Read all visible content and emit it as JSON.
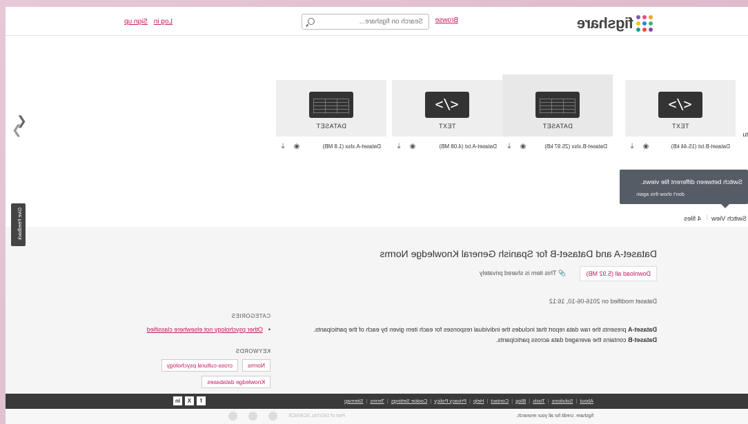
{
  "header": {
    "logo_text": "figshare",
    "browse": "Browse",
    "search_placeholder": "Search on figshare...",
    "login": "Log in",
    "signup": "Sign up"
  },
  "carousel": {
    "tiles": [
      {
        "type": "TEXT",
        "icon": "code-file-icon",
        "filename": "Dataset-B.txt (15.44 kB)"
      },
      {
        "type": "DATASET",
        "icon": "spreadsheet-icon",
        "filename": "Dataset-B.xlsx (25.97 kB)"
      },
      {
        "type": "TEXT",
        "icon": "code-file-icon",
        "filename": "Dataset-A.txt (4.08 MB)"
      },
      {
        "type": "DATASET",
        "icon": "spreadsheet-icon",
        "filename": "Dataset-A.xlsx (1.8 MB)"
      }
    ],
    "edge_text": "tu"
  },
  "tooltip": {
    "title": "Switch between different file views.",
    "dismiss": "don't show this again"
  },
  "view_bar": {
    "switch_view": "Switch View",
    "file_count": "4 files"
  },
  "item": {
    "title": "Dataset-A and Dataset-B for Spanish General Knowledge Norms",
    "download_all": "Download all (5.92 MB)",
    "shared": "This item is shared privately",
    "modified": "Dataset modified on 2016-06-10, 16:12",
    "desc_a_label": "Dataset-A",
    "desc_a": " presents the raw data report that includes the individual responses for each item given by each of the participants.",
    "desc_b_label": "Dataset-B",
    "desc_b": " contains the averaged data across participants."
  },
  "side": {
    "categories_head": "CATEGORIES",
    "categories": [
      "Other psychology not elsewhere classified"
    ],
    "keywords_head": "KEYWORDS",
    "keywords": [
      "Norms",
      "cross-cultural psychology",
      "Knowledge databases"
    ]
  },
  "footer": {
    "links": [
      "About",
      "Solutions",
      "Tools",
      "Blog",
      "Contact",
      "Help",
      "Privacy Policy",
      "Cookie Settings",
      "Terms",
      "Sitemap"
    ],
    "social": [
      "f",
      "X",
      "in"
    ],
    "credit": "figshare. credit for all your research.",
    "partner_text": "Part of DIGITAL SCIENCE"
  },
  "feedback": "Give Feedback"
}
